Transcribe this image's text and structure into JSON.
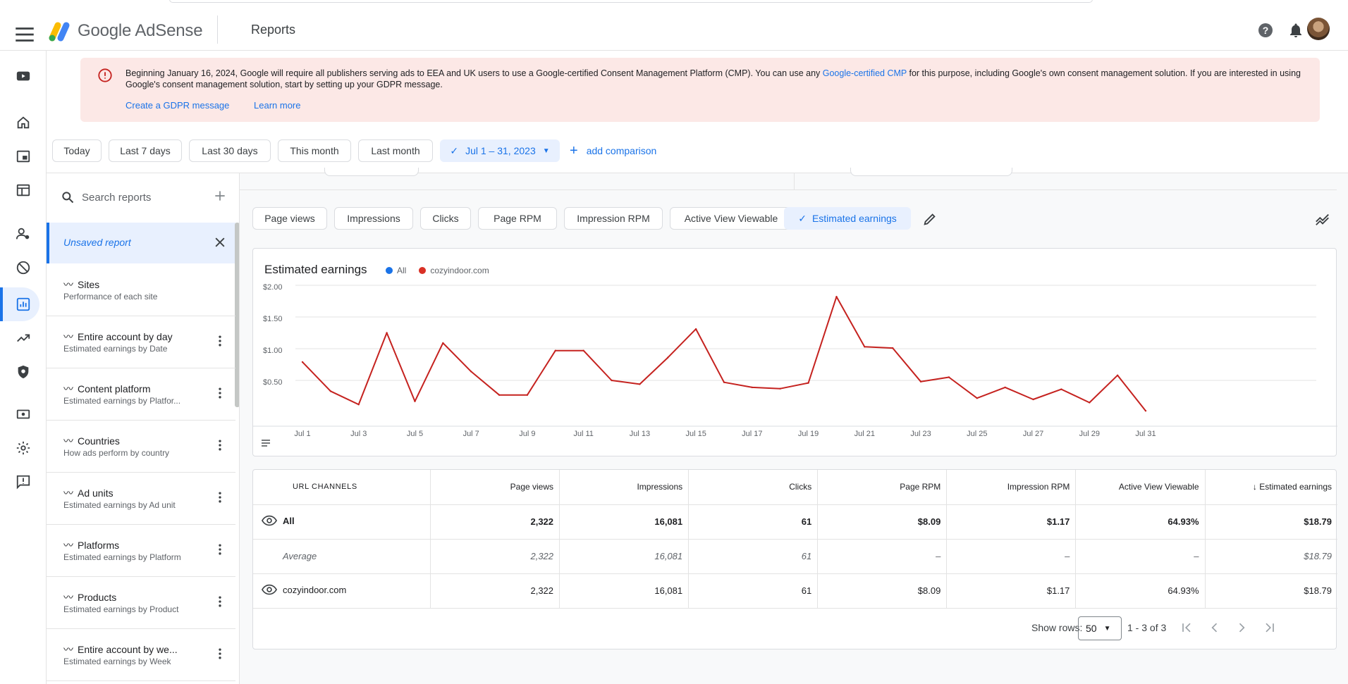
{
  "app": {
    "brand": "Google AdSense",
    "page_title": "Reports"
  },
  "banner": {
    "message_before": "Beginning January 16, 2024, Google will require all publishers serving ads to EEA and UK users to use a Google-certified Consent Management Platform (CMP). You can use any ",
    "message_link": "Google-certified CMP",
    "message_after": " for this purpose, including Google's own consent management solution. If you are interested in using Google's consent management solution, start by setting up your GDPR message.",
    "action_create": "Create a GDPR message",
    "action_learn": "Learn more"
  },
  "date_filters": [
    "Today",
    "Last 7 days",
    "Last 30 days",
    "This month",
    "Last month"
  ],
  "date_selected": "Jul 1 – 31, 2023",
  "add_comparison": "add comparison",
  "reports_panel": {
    "search_placeholder": "Search reports",
    "unsaved": "Unsaved report",
    "items": [
      {
        "title": "Sites",
        "subtitle": "Performance of each site"
      },
      {
        "title": "Entire account by day",
        "subtitle": "Estimated earnings by Date"
      },
      {
        "title": "Content platform",
        "subtitle": "Estimated earnings by Platfor..."
      },
      {
        "title": "Countries",
        "subtitle": "How ads perform by country"
      },
      {
        "title": "Ad units",
        "subtitle": "Estimated earnings by Ad unit"
      },
      {
        "title": "Platforms",
        "subtitle": "Estimated earnings by Platform"
      },
      {
        "title": "Products",
        "subtitle": "Estimated earnings by Product"
      },
      {
        "title": "Entire account by we...",
        "subtitle": "Estimated earnings by Week"
      }
    ]
  },
  "metrics": [
    "Page views",
    "Impressions",
    "Clicks",
    "Page RPM",
    "Impression RPM",
    "Active View Viewable",
    "Estimated earnings"
  ],
  "metric_selected": "Estimated earnings",
  "chart_data": {
    "type": "line",
    "title": "Estimated earnings",
    "legend": [
      {
        "name": "All",
        "color": "#1a73e8"
      },
      {
        "name": "cozyindoor.com",
        "color": "#d93025"
      }
    ],
    "y_ticks": [
      "$0.50",
      "$1.00",
      "$1.50",
      "$2.00"
    ],
    "ylim": [
      0,
      2.0
    ],
    "x_ticks": [
      "Jul 1",
      "Jul 3",
      "Jul 5",
      "Jul 7",
      "Jul 9",
      "Jul 11",
      "Jul 13",
      "Jul 15",
      "Jul 17",
      "Jul 19",
      "Jul 21",
      "Jul 23",
      "Jul 25",
      "Jul 27",
      "Jul 29",
      "Jul 31"
    ],
    "series": [
      {
        "name": "cozyindoor.com",
        "color": "#c5221f",
        "x": [
          1,
          2,
          3,
          4,
          5,
          6,
          7,
          8,
          9,
          10,
          11,
          12,
          13,
          14,
          15,
          16,
          17,
          18,
          19,
          20,
          21,
          22,
          23,
          24,
          25,
          26,
          27,
          28,
          29,
          30,
          31
        ],
        "values": [
          0.79,
          0.33,
          0.12,
          1.25,
          0.17,
          1.09,
          0.64,
          0.27,
          0.27,
          0.97,
          0.97,
          0.5,
          0.44,
          0.86,
          1.31,
          0.47,
          0.39,
          0.37,
          0.46,
          1.82,
          1.03,
          1.01,
          0.48,
          0.55,
          0.22,
          0.39,
          0.2,
          0.36,
          0.15,
          0.58,
          0.02
        ]
      }
    ]
  },
  "table": {
    "columns": [
      "URL CHANNELS",
      "Page views",
      "Impressions",
      "Clicks",
      "Page RPM",
      "Impression RPM",
      "Active View Viewable",
      "Estimated earnings"
    ],
    "rows": [
      {
        "name": "All",
        "cells": [
          "2,322",
          "16,081",
          "61",
          "$8.09",
          "$1.17",
          "64.93%",
          "$18.79"
        ]
      },
      {
        "name": "Average",
        "cells": [
          "2,322",
          "16,081",
          "61",
          "–",
          "–",
          "–",
          "$18.79"
        ]
      },
      {
        "name": "cozyindoor.com",
        "cells": [
          "2,322",
          "16,081",
          "61",
          "$8.09",
          "$1.17",
          "64.93%",
          "$18.79"
        ]
      }
    ],
    "show_rows_label": "Show rows:",
    "show_rows_value": "50",
    "range": "1 - 3 of 3"
  }
}
